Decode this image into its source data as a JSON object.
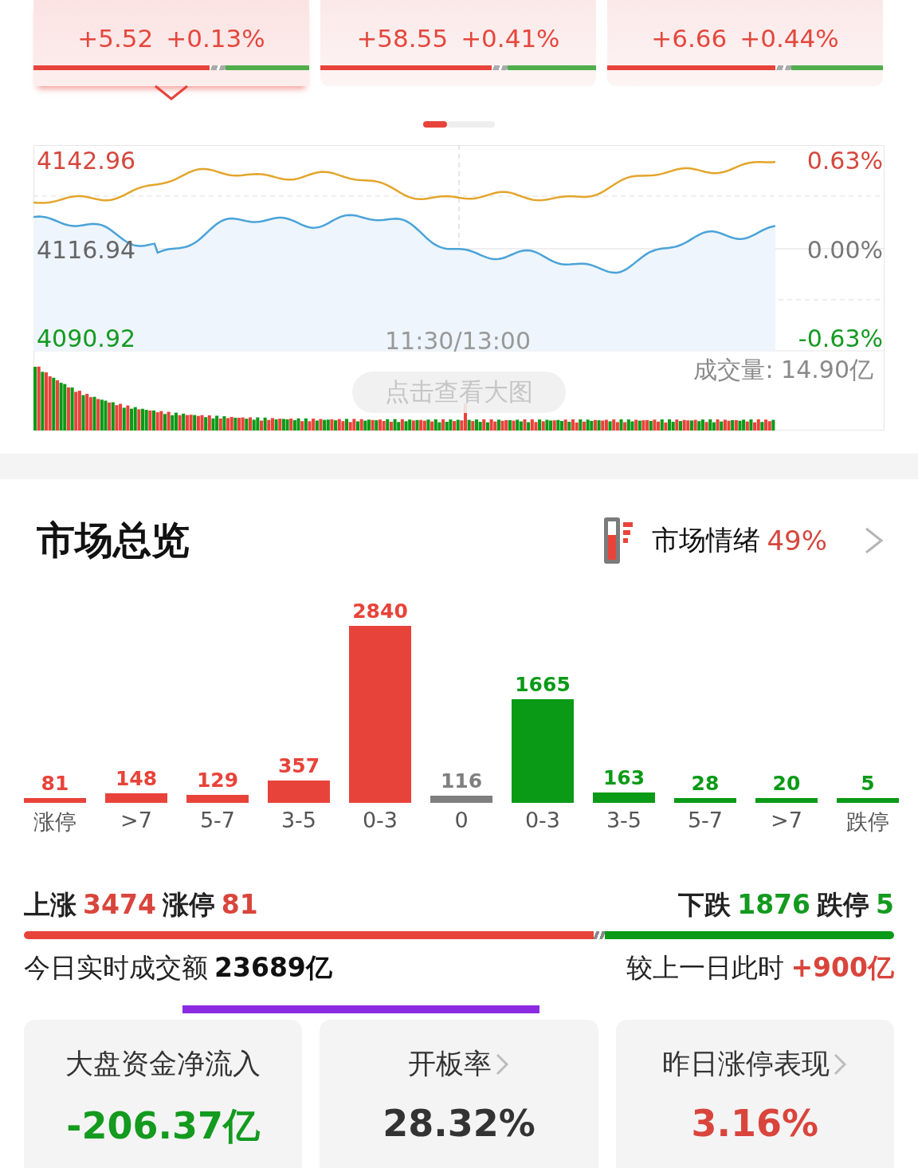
{
  "index_cards": [
    {
      "change": "+5.52",
      "percent": "+0.13%",
      "level": 0.64,
      "selected": true
    },
    {
      "change": "+58.55",
      "percent": "+0.41%",
      "level": 0.62,
      "selected": false
    },
    {
      "change": "+6.66",
      "percent": "+0.44%",
      "level": 0.61,
      "selected": false
    }
  ],
  "intraday": {
    "high": "4142.96",
    "base": "4116.94",
    "low": "4090.92",
    "high_pct": "0.63%",
    "base_pct": "0.00%",
    "low_pct": "-0.63%",
    "midtime": "11:30/13:00",
    "volume": "成交量: 14.90亿",
    "hint": "点击查看大图"
  },
  "overview": {
    "title": "市场总览",
    "sentiment_label": "市场情绪",
    "sentiment_value": "49%",
    "buckets": [
      {
        "label": "涨停",
        "value": "81",
        "color": "#e8433a"
      },
      {
        "label": ">7",
        "value": "148",
        "color": "#e8433a"
      },
      {
        "label": "5-7",
        "value": "129",
        "color": "#e8433a"
      },
      {
        "label": "3-5",
        "value": "357",
        "color": "#e8433a"
      },
      {
        "label": "0-3",
        "value": "2840",
        "color": "#e8433a"
      },
      {
        "label": "0",
        "value": "116",
        "color": "#7f7f7f"
      },
      {
        "label": "0-3",
        "value": "1665",
        "color": "#0a9a16"
      },
      {
        "label": "3-5",
        "value": "163",
        "color": "#0a9a16"
      },
      {
        "label": "5-7",
        "value": "28",
        "color": "#0a9a16"
      },
      {
        "label": ">7",
        "value": "20",
        "color": "#0a9a16"
      },
      {
        "label": "跌停",
        "value": "5",
        "color": "#0a9a16"
      }
    ],
    "rise_label": "上涨",
    "rise_count": "3474",
    "limit_up_label": "涨停",
    "limit_up_count": "81",
    "fall_label": "下跌",
    "fall_count": "1876",
    "limit_down_label": "跌停",
    "limit_down_count": "5",
    "ratio": {
      "level": 0.655
    },
    "turnover_label": "今日实时成交额",
    "turnover_value": "23689亿",
    "compare_label": "较上一日此时",
    "compare_value": "+900亿"
  },
  "stat_cards": [
    {
      "title": "大盘资金净流入",
      "value": "-206.37亿",
      "color": "#139a1f",
      "link": false
    },
    {
      "title": "开板率",
      "value": "28.32%",
      "color": "#333333",
      "link": true
    },
    {
      "title": "昨日涨停表现",
      "value": "3.16%",
      "color": "#d9453c",
      "link": true
    }
  ]
}
